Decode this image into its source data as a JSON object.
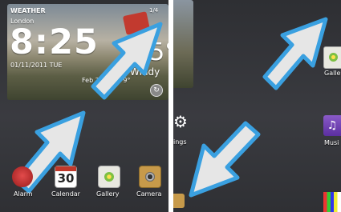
{
  "weather_widget": {
    "brand": "WEATHER",
    "city": "London",
    "time": "8:25",
    "date": "01/11/2011 TUE",
    "temperature": "15°",
    "condition": "Windy",
    "forecast": "Feb 24 16° / 9°",
    "page_indicator": "1/4"
  },
  "dock": {
    "apps": [
      {
        "label": "Alarm"
      },
      {
        "label": "Calendar",
        "day": "30"
      },
      {
        "label": "Gallery"
      },
      {
        "label": "Camera"
      }
    ]
  },
  "right_panel": {
    "labels": {
      "settings_partial": "ings",
      "gallery_partial": "Galle",
      "music_partial": "Musi"
    }
  },
  "colors": {
    "arrow_fill": "#e6e6e6",
    "arrow_outline": "#3aa0e0",
    "background": "#34353a"
  }
}
